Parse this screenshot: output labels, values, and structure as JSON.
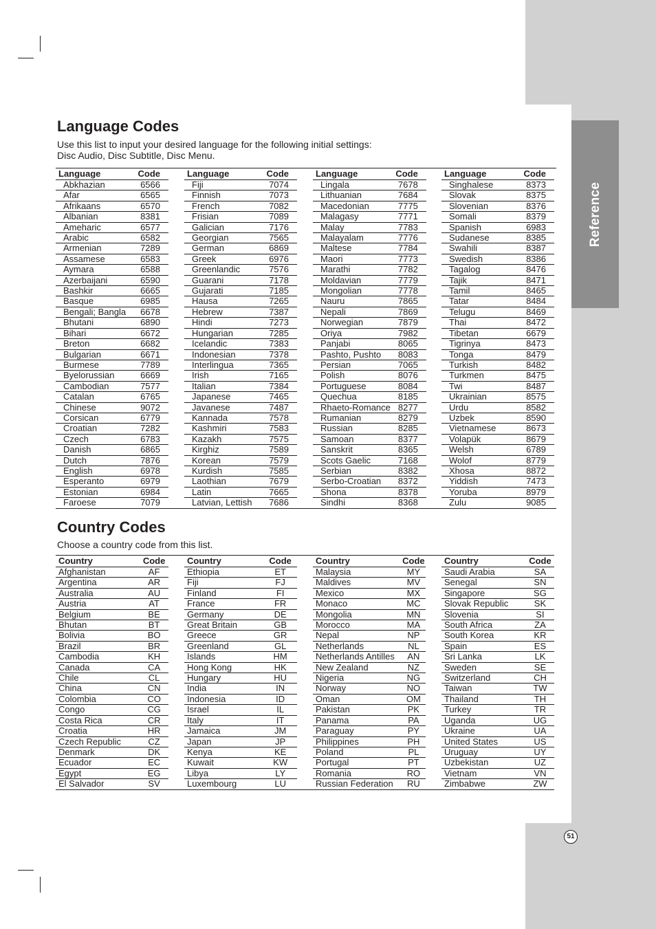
{
  "page": {
    "side_tab": "Reference",
    "page_number": "51"
  },
  "language_section": {
    "title": "Language Codes",
    "intro_line1": "Use this list to input your desired language for the following initial settings:",
    "intro_line2": "Disc Audio, Disc Subtitle, Disc Menu.",
    "header_name": "Language",
    "header_code": "Code",
    "columns": [
      [
        [
          "Abkhazian",
          "6566"
        ],
        [
          "Afar",
          "6565"
        ],
        [
          "Afrikaans",
          "6570"
        ],
        [
          "Albanian",
          "8381"
        ],
        [
          "Ameharic",
          "6577"
        ],
        [
          "Arabic",
          "6582"
        ],
        [
          "Armenian",
          "7289"
        ],
        [
          "Assamese",
          "6583"
        ],
        [
          "Aymara",
          "6588"
        ],
        [
          "Azerbaijani",
          "6590"
        ],
        [
          "Bashkir",
          "6665"
        ],
        [
          "Basque",
          "6985"
        ],
        [
          "Bengali; Bangla",
          "6678"
        ],
        [
          "Bhutani",
          "6890"
        ],
        [
          "Bihari",
          "6672"
        ],
        [
          "Breton",
          "6682"
        ],
        [
          "Bulgarian",
          "6671"
        ],
        [
          "Burmese",
          "7789"
        ],
        [
          "Byelorussian",
          "6669"
        ],
        [
          "Cambodian",
          "7577"
        ],
        [
          "Catalan",
          "6765"
        ],
        [
          "Chinese",
          "9072"
        ],
        [
          "Corsican",
          "6779"
        ],
        [
          "Croatian",
          "7282"
        ],
        [
          "Czech",
          "6783"
        ],
        [
          "Danish",
          "6865"
        ],
        [
          "Dutch",
          "7876"
        ],
        [
          "English",
          "6978"
        ],
        [
          "Esperanto",
          "6979"
        ],
        [
          "Estonian",
          "6984"
        ],
        [
          "Faroese",
          "7079"
        ]
      ],
      [
        [
          "Fiji",
          "7074"
        ],
        [
          "Finnish",
          "7073"
        ],
        [
          "French",
          "7082"
        ],
        [
          "Frisian",
          "7089"
        ],
        [
          "Galician",
          "7176"
        ],
        [
          "Georgian",
          "7565"
        ],
        [
          "German",
          "6869"
        ],
        [
          "Greek",
          "6976"
        ],
        [
          "Greenlandic",
          "7576"
        ],
        [
          "Guarani",
          "7178"
        ],
        [
          "Gujarati",
          "7185"
        ],
        [
          "Hausa",
          "7265"
        ],
        [
          "Hebrew",
          "7387"
        ],
        [
          "Hindi",
          "7273"
        ],
        [
          "Hungarian",
          "7285"
        ],
        [
          "Icelandic",
          "7383"
        ],
        [
          "Indonesian",
          "7378"
        ],
        [
          "Interlingua",
          "7365"
        ],
        [
          "Irish",
          "7165"
        ],
        [
          "Italian",
          "7384"
        ],
        [
          "Japanese",
          "7465"
        ],
        [
          "Javanese",
          "7487"
        ],
        [
          "Kannada",
          "7578"
        ],
        [
          "Kashmiri",
          "7583"
        ],
        [
          "Kazakh",
          "7575"
        ],
        [
          "Kirghiz",
          "7589"
        ],
        [
          "Korean",
          "7579"
        ],
        [
          "Kurdish",
          "7585"
        ],
        [
          "Laothian",
          "7679"
        ],
        [
          "Latin",
          "7665"
        ],
        [
          "Latvian, Lettish",
          "7686"
        ]
      ],
      [
        [
          "Lingala",
          "7678"
        ],
        [
          "Lithuanian",
          "7684"
        ],
        [
          "Macedonian",
          "7775"
        ],
        [
          "Malagasy",
          "7771"
        ],
        [
          "Malay",
          "7783"
        ],
        [
          "Malayalam",
          "7776"
        ],
        [
          "Maltese",
          "7784"
        ],
        [
          "Maori",
          "7773"
        ],
        [
          "Marathi",
          "7782"
        ],
        [
          "Moldavian",
          "7779"
        ],
        [
          "Mongolian",
          "7778"
        ],
        [
          "Nauru",
          "7865"
        ],
        [
          "Nepali",
          "7869"
        ],
        [
          "Norwegian",
          "7879"
        ],
        [
          "Oriya",
          "7982"
        ],
        [
          "Panjabi",
          "8065"
        ],
        [
          "Pashto, Pushto",
          "8083"
        ],
        [
          "Persian",
          "7065"
        ],
        [
          "Polish",
          "8076"
        ],
        [
          "Portuguese",
          "8084"
        ],
        [
          "Quechua",
          "8185"
        ],
        [
          "Rhaeto-Romance",
          "8277"
        ],
        [
          "Rumanian",
          "8279"
        ],
        [
          "Russian",
          "8285"
        ],
        [
          "Samoan",
          "8377"
        ],
        [
          "Sanskrit",
          "8365"
        ],
        [
          "Scots Gaelic",
          "7168"
        ],
        [
          "Serbian",
          "8382"
        ],
        [
          "Serbo-Croatian",
          "8372"
        ],
        [
          "Shona",
          "8378"
        ],
        [
          "Sindhi",
          "8368"
        ]
      ],
      [
        [
          "Singhalese",
          "8373"
        ],
        [
          "Slovak",
          "8375"
        ],
        [
          "Slovenian",
          "8376"
        ],
        [
          "Somali",
          "8379"
        ],
        [
          "Spanish",
          "6983"
        ],
        [
          "Sudanese",
          "8385"
        ],
        [
          "Swahili",
          "8387"
        ],
        [
          "Swedish",
          "8386"
        ],
        [
          "Tagalog",
          "8476"
        ],
        [
          "Tajik",
          "8471"
        ],
        [
          "Tamil",
          "8465"
        ],
        [
          "Tatar",
          "8484"
        ],
        [
          "Telugu",
          "8469"
        ],
        [
          "Thai",
          "8472"
        ],
        [
          "Tibetan",
          "6679"
        ],
        [
          "Tigrinya",
          "8473"
        ],
        [
          "Tonga",
          "8479"
        ],
        [
          "Turkish",
          "8482"
        ],
        [
          "Turkmen",
          "8475"
        ],
        [
          "Twi",
          "8487"
        ],
        [
          "Ukrainian",
          "8575"
        ],
        [
          "Urdu",
          "8582"
        ],
        [
          "Uzbek",
          "8590"
        ],
        [
          "Vietnamese",
          "8673"
        ],
        [
          "Volapük",
          "8679"
        ],
        [
          "Welsh",
          "6789"
        ],
        [
          "Wolof",
          "8779"
        ],
        [
          "Xhosa",
          "8872"
        ],
        [
          "Yiddish",
          "7473"
        ],
        [
          "Yoruba",
          "8979"
        ],
        [
          "Zulu",
          "9085"
        ]
      ]
    ]
  },
  "country_section": {
    "title": "Country Codes",
    "intro": "Choose a country code from this list.",
    "header_name": "Country",
    "header_code": "Code",
    "columns": [
      [
        [
          "Afghanistan",
          "AF"
        ],
        [
          "Argentina",
          "AR"
        ],
        [
          "Australia",
          "AU"
        ],
        [
          "Austria",
          "AT"
        ],
        [
          "Belgium",
          "BE"
        ],
        [
          "Bhutan",
          "BT"
        ],
        [
          "Bolivia",
          "BO"
        ],
        [
          "Brazil",
          "BR"
        ],
        [
          "Cambodia",
          "KH"
        ],
        [
          "Canada",
          "CA"
        ],
        [
          "Chile",
          "CL"
        ],
        [
          "China",
          "CN"
        ],
        [
          "Colombia",
          "CO"
        ],
        [
          "Congo",
          "CG"
        ],
        [
          "Costa Rica",
          "CR"
        ],
        [
          "Croatia",
          "HR"
        ],
        [
          "Czech Republic",
          "CZ"
        ],
        [
          "Denmark",
          "DK"
        ],
        [
          "Ecuador",
          "EC"
        ],
        [
          "Egypt",
          "EG"
        ],
        [
          "El Salvador",
          "SV"
        ]
      ],
      [
        [
          "Ethiopia",
          "ET"
        ],
        [
          "Fiji",
          "FJ"
        ],
        [
          "Finland",
          "FI"
        ],
        [
          "France",
          "FR"
        ],
        [
          "Germany",
          "DE"
        ],
        [
          "Great Britain",
          "GB"
        ],
        [
          "Greece",
          "GR"
        ],
        [
          "Greenland",
          "GL"
        ],
        [
          "Islands",
          "HM"
        ],
        [
          "Hong Kong",
          "HK"
        ],
        [
          "Hungary",
          "HU"
        ],
        [
          "India",
          "IN"
        ],
        [
          "Indonesia",
          "ID"
        ],
        [
          "Israel",
          "IL"
        ],
        [
          "Italy",
          "IT"
        ],
        [
          "Jamaica",
          "JM"
        ],
        [
          "Japan",
          "JP"
        ],
        [
          "Kenya",
          "KE"
        ],
        [
          "Kuwait",
          "KW"
        ],
        [
          "Libya",
          "LY"
        ],
        [
          "Luxembourg",
          "LU"
        ]
      ],
      [
        [
          "Malaysia",
          "MY"
        ],
        [
          "Maldives",
          "MV"
        ],
        [
          "Mexico",
          "MX"
        ],
        [
          "Monaco",
          "MC"
        ],
        [
          "Mongolia",
          "MN"
        ],
        [
          "Morocco",
          "MA"
        ],
        [
          "Nepal",
          "NP"
        ],
        [
          "Netherlands",
          "NL"
        ],
        [
          "Netherlands Antilles",
          "AN"
        ],
        [
          "New Zealand",
          "NZ"
        ],
        [
          "Nigeria",
          "NG"
        ],
        [
          "Norway",
          "NO"
        ],
        [
          "Oman",
          "OM"
        ],
        [
          "Pakistan",
          "PK"
        ],
        [
          "Panama",
          "PA"
        ],
        [
          "Paraguay",
          "PY"
        ],
        [
          "Philippines",
          "PH"
        ],
        [
          "Poland",
          "PL"
        ],
        [
          "Portugal",
          "PT"
        ],
        [
          "Romania",
          "RO"
        ],
        [
          "Russian Federation",
          "RU"
        ]
      ],
      [
        [
          "Saudi Arabia",
          "SA"
        ],
        [
          "Senegal",
          "SN"
        ],
        [
          "Singapore",
          "SG"
        ],
        [
          "Slovak Republic",
          "SK"
        ],
        [
          "Slovenia",
          "SI"
        ],
        [
          "South Africa",
          "ZA"
        ],
        [
          "South Korea",
          "KR"
        ],
        [
          "Spain",
          "ES"
        ],
        [
          "Sri Lanka",
          "LK"
        ],
        [
          "Sweden",
          "SE"
        ],
        [
          "Switzerland",
          "CH"
        ],
        [
          "Taiwan",
          "TW"
        ],
        [
          "Thailand",
          "TH"
        ],
        [
          "Turkey",
          "TR"
        ],
        [
          "Uganda",
          "UG"
        ],
        [
          "Ukraine",
          "UA"
        ],
        [
          "United States",
          "US"
        ],
        [
          "Uruguay",
          "UY"
        ],
        [
          "Uzbekistan",
          "UZ"
        ],
        [
          "Vietnam",
          "VN"
        ],
        [
          "Zimbabwe",
          "ZW"
        ]
      ]
    ]
  }
}
